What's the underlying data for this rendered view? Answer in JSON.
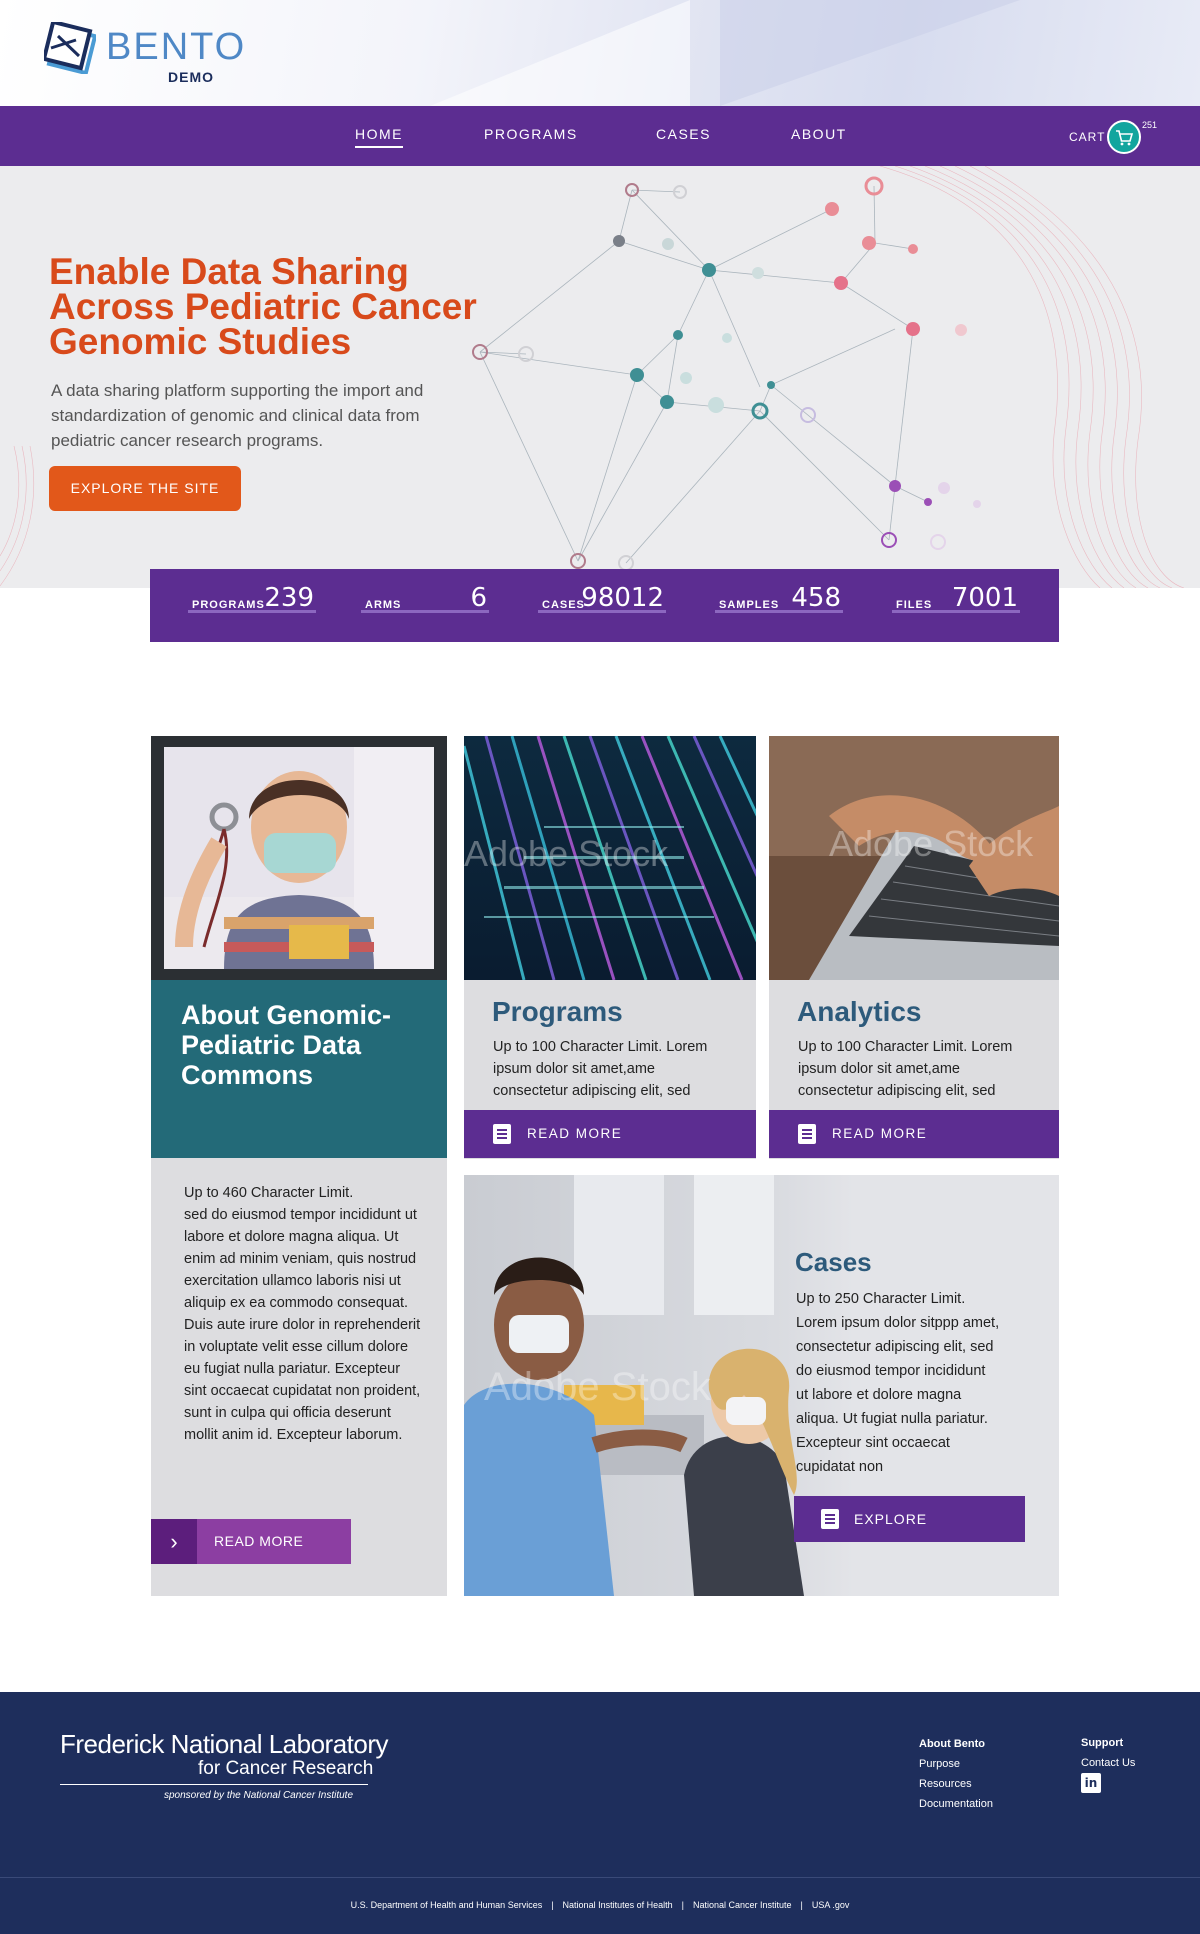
{
  "header": {
    "logo_text": "BENTO",
    "logo_sub": "DEMO"
  },
  "nav": {
    "items": [
      {
        "label": "HOME",
        "active": true
      },
      {
        "label": "PROGRAMS",
        "active": false
      },
      {
        "label": "CASES",
        "active": false
      },
      {
        "label": "ABOUT",
        "active": false
      }
    ],
    "cart_label": "CART",
    "cart_count": "251"
  },
  "hero": {
    "title": "Enable Data Sharing Across Pediatric Cancer Genomic Studies",
    "description": "A data sharing platform supporting the import and standardization of genomic and clinical data from pediatric cancer research programs.",
    "button": "EXPLORE THE SITE"
  },
  "stats": [
    {
      "label": "PROGRAMS",
      "value": "239"
    },
    {
      "label": "ARMS",
      "value": "6"
    },
    {
      "label": "CASES",
      "value": "98012"
    },
    {
      "label": "SAMPLES",
      "value": "458"
    },
    {
      "label": "FILES",
      "value": "7001"
    }
  ],
  "about": {
    "title": "About Genomic-Pediatric Data Commons",
    "body": "Up to 460 Character Limit.\nsed do eiusmod tempor incididunt ut labore et dolore magna aliqua. Ut enim ad minim veniam, quis nostrud exercitation ullamco laboris nisi ut aliquip ex ea commodo consequat. Duis aute irure dolor in reprehenderit in voluptate velit esse cillum dolore eu fugiat nulla pariatur. Excepteur sint occaecat cupidatat non proident, sunt in culpa qui officia deserunt mollit anim id. Excepteur  laborum.",
    "button": "READ MORE"
  },
  "programs_card": {
    "title": "Programs",
    "body": "Up to 100 Character Limit. Lorem ipsum dolor sit amet,ame consectetur adipiscing elit, sed",
    "button": "READ MORE"
  },
  "analytics_card": {
    "title": "Analytics",
    "body": "Up to 100 Character Limit. Lorem ipsum dolor sit amet,ame consectetur adipiscing elit, sed",
    "button": "READ MORE"
  },
  "cases_card": {
    "title": "Cases",
    "body": "Up to 250 Character Limit. Lorem ipsum dolor sitppp amet, consectetur adipiscing elit, sed do eiusmod tempor incididunt ut labore et dolore magna aliqua. Ut fugiat nulla pariatur. Excepteur sint occaecat cupidatat non",
    "button": "EXPLORE"
  },
  "watermark": "Adobe Stock",
  "footer": {
    "org_title": "Frederick National Laboratory",
    "org_sub": "for Cancer Research",
    "org_sponsor": "sponsored by the National Cancer Institute",
    "col1_head": "About Bento",
    "col1_links": [
      "Purpose",
      "Resources",
      "Documentation"
    ],
    "col2_head": "Support",
    "col2_links": [
      "Contact Us"
    ],
    "bottom_links": [
      "U.S. Department of Health and Human Services",
      "National Institutes of Health",
      "National Cancer Institute",
      "USA .gov"
    ]
  },
  "colors": {
    "brand_purple": "#5c2d91",
    "hero_title": "#d84a1b",
    "cta_orange": "#e2581a",
    "teal": "#236a78",
    "footer_navy": "#1e2e5c"
  }
}
